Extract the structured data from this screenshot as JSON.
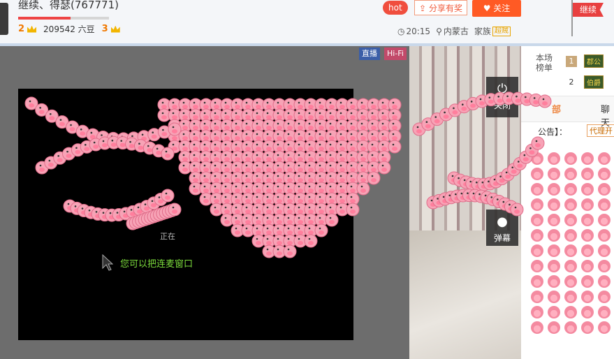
{
  "room": {
    "title": "继续、得瑟(767771)",
    "level_left": "2",
    "beans": "209542 六豆",
    "level_right": "3",
    "progress": 0.58
  },
  "header": {
    "hot": "hot",
    "share": "分享有奖",
    "follow": "关注",
    "time": "20:15",
    "location": "内蒙古",
    "family_label": "家族",
    "family_badge": "超贼",
    "flag_label": "继续"
  },
  "stage": {
    "tag_live": "直播",
    "tag_hifi": "Hi-Fi",
    "hint": "您可以把连麦窗口",
    "loading": "正在",
    "close_label": "关闭",
    "danmu_label": "弹幕"
  },
  "rank": {
    "title": "本场榜单",
    "rows": [
      {
        "num": "1",
        "badge": "郡公"
      },
      {
        "num": "2",
        "badge": "伯爵"
      }
    ]
  },
  "chat": {
    "tab_all": "部",
    "tab_chat": "聊天",
    "notice": "公告】：",
    "notice_tag": "代理开"
  },
  "colors": {
    "accent": "#ff5a24",
    "hot": "#f04e3e",
    "pig": "#f48aa0"
  }
}
